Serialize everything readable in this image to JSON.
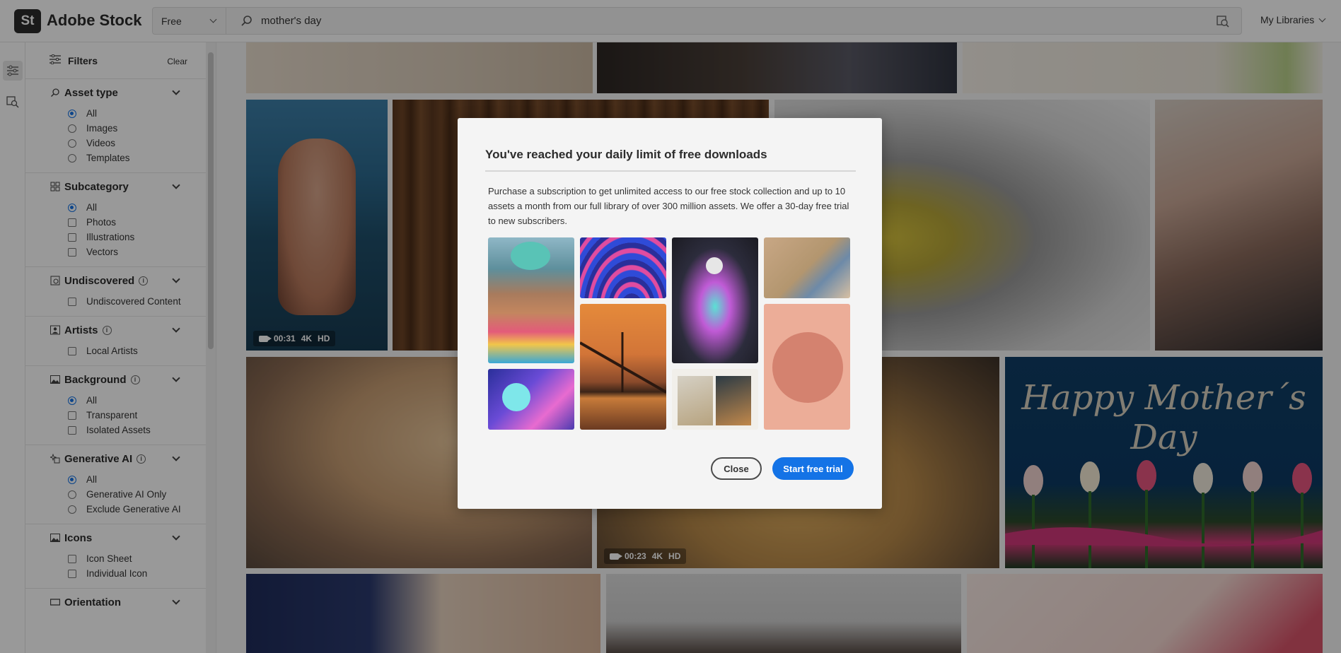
{
  "header": {
    "logo_mark": "St",
    "app_name": "Adobe Stock",
    "license_filter": "Free",
    "search_value": "mother's day",
    "my_libraries": "My Libraries"
  },
  "sidebar": {
    "title": "Filters",
    "clear_label": "Clear",
    "asset_type": {
      "title": "Asset type",
      "options": [
        "All",
        "Images",
        "Videos",
        "Templates"
      ],
      "selected": "All"
    },
    "subcategory": {
      "title": "Subcategory",
      "options": [
        "All",
        "Photos",
        "Illustrations",
        "Vectors"
      ],
      "selected": "All"
    },
    "undiscovered": {
      "title": "Undiscovered",
      "options": [
        "Undiscovered Content"
      ]
    },
    "artists": {
      "title": "Artists",
      "options": [
        "Local Artists"
      ]
    },
    "background": {
      "title": "Background",
      "options": [
        "All",
        "Transparent",
        "Isolated Assets"
      ],
      "selected": "All"
    },
    "generative_ai": {
      "title": "Generative AI",
      "options": [
        "All",
        "Generative AI Only",
        "Exclude Generative AI"
      ],
      "selected": "All"
    },
    "icons": {
      "title": "Icons",
      "options": [
        "Icon Sheet",
        "Individual Icon"
      ]
    },
    "orientation": {
      "title": "Orientation"
    }
  },
  "grid": {
    "video1": {
      "duration": "00:31",
      "res": "4K",
      "quality": "HD"
    },
    "video2": {
      "duration": "00:23",
      "res": "4K",
      "quality": "HD"
    },
    "mothers_day_text": "Happy Mother´s Day"
  },
  "modal": {
    "title": "You've reached your daily limit of free downloads",
    "body": "Purchase a subscription to get unlimited access to our free stock collection and up to 10 assets a month from our full library of over 300 million assets. We offer a 30-day free trial to new subscribers.",
    "close_label": "Close",
    "trial_label": "Start free trial"
  }
}
